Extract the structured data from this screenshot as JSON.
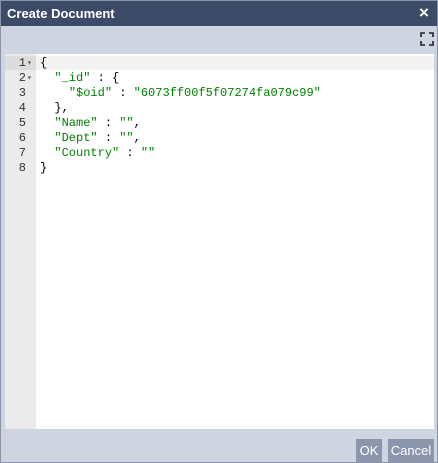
{
  "dialog": {
    "title": "Create Document",
    "close_icon": "×",
    "expand_icon": "fullscreen-expand-icon"
  },
  "editor": {
    "lines": [
      {
        "num": "1",
        "fold": "▾",
        "indent": "",
        "parts": [
          {
            "t": "{",
            "c": "punc"
          }
        ]
      },
      {
        "num": "2",
        "fold": "▾",
        "indent": "  ",
        "parts": [
          {
            "t": "\"_id\"",
            "c": "key"
          },
          {
            "t": " : {",
            "c": "punc"
          }
        ]
      },
      {
        "num": "3",
        "fold": "",
        "indent": "    ",
        "parts": [
          {
            "t": "\"$oid\"",
            "c": "key"
          },
          {
            "t": " : ",
            "c": "punc"
          },
          {
            "t": "\"6073ff00f5f07274fa079c99\"",
            "c": "str"
          }
        ]
      },
      {
        "num": "4",
        "fold": "",
        "indent": "  ",
        "parts": [
          {
            "t": "},",
            "c": "punc"
          }
        ]
      },
      {
        "num": "5",
        "fold": "",
        "indent": "  ",
        "parts": [
          {
            "t": "\"Name\"",
            "c": "key"
          },
          {
            "t": " : ",
            "c": "punc"
          },
          {
            "t": "\"\"",
            "c": "str"
          },
          {
            "t": ",",
            "c": "punc"
          }
        ]
      },
      {
        "num": "6",
        "fold": "",
        "indent": "  ",
        "parts": [
          {
            "t": "\"Dept\"",
            "c": "key"
          },
          {
            "t": " : ",
            "c": "punc"
          },
          {
            "t": "\"\"",
            "c": "str"
          },
          {
            "t": ",",
            "c": "punc"
          }
        ]
      },
      {
        "num": "7",
        "fold": "",
        "indent": "  ",
        "parts": [
          {
            "t": "\"Country\"",
            "c": "key"
          },
          {
            "t": " : ",
            "c": "punc"
          },
          {
            "t": "\"\"",
            "c": "str"
          }
        ]
      },
      {
        "num": "8",
        "fold": "",
        "indent": "",
        "parts": [
          {
            "t": "}",
            "c": "punc"
          }
        ]
      }
    ]
  },
  "buttons": {
    "ok_label": "OK",
    "cancel_label": "Cancel"
  },
  "colors": {
    "titlebar": "#3c4b68",
    "dialog_bg": "#cfd4e1",
    "button_bg": "#8b95ab",
    "json_key": "#008000",
    "json_string": "#008000"
  }
}
